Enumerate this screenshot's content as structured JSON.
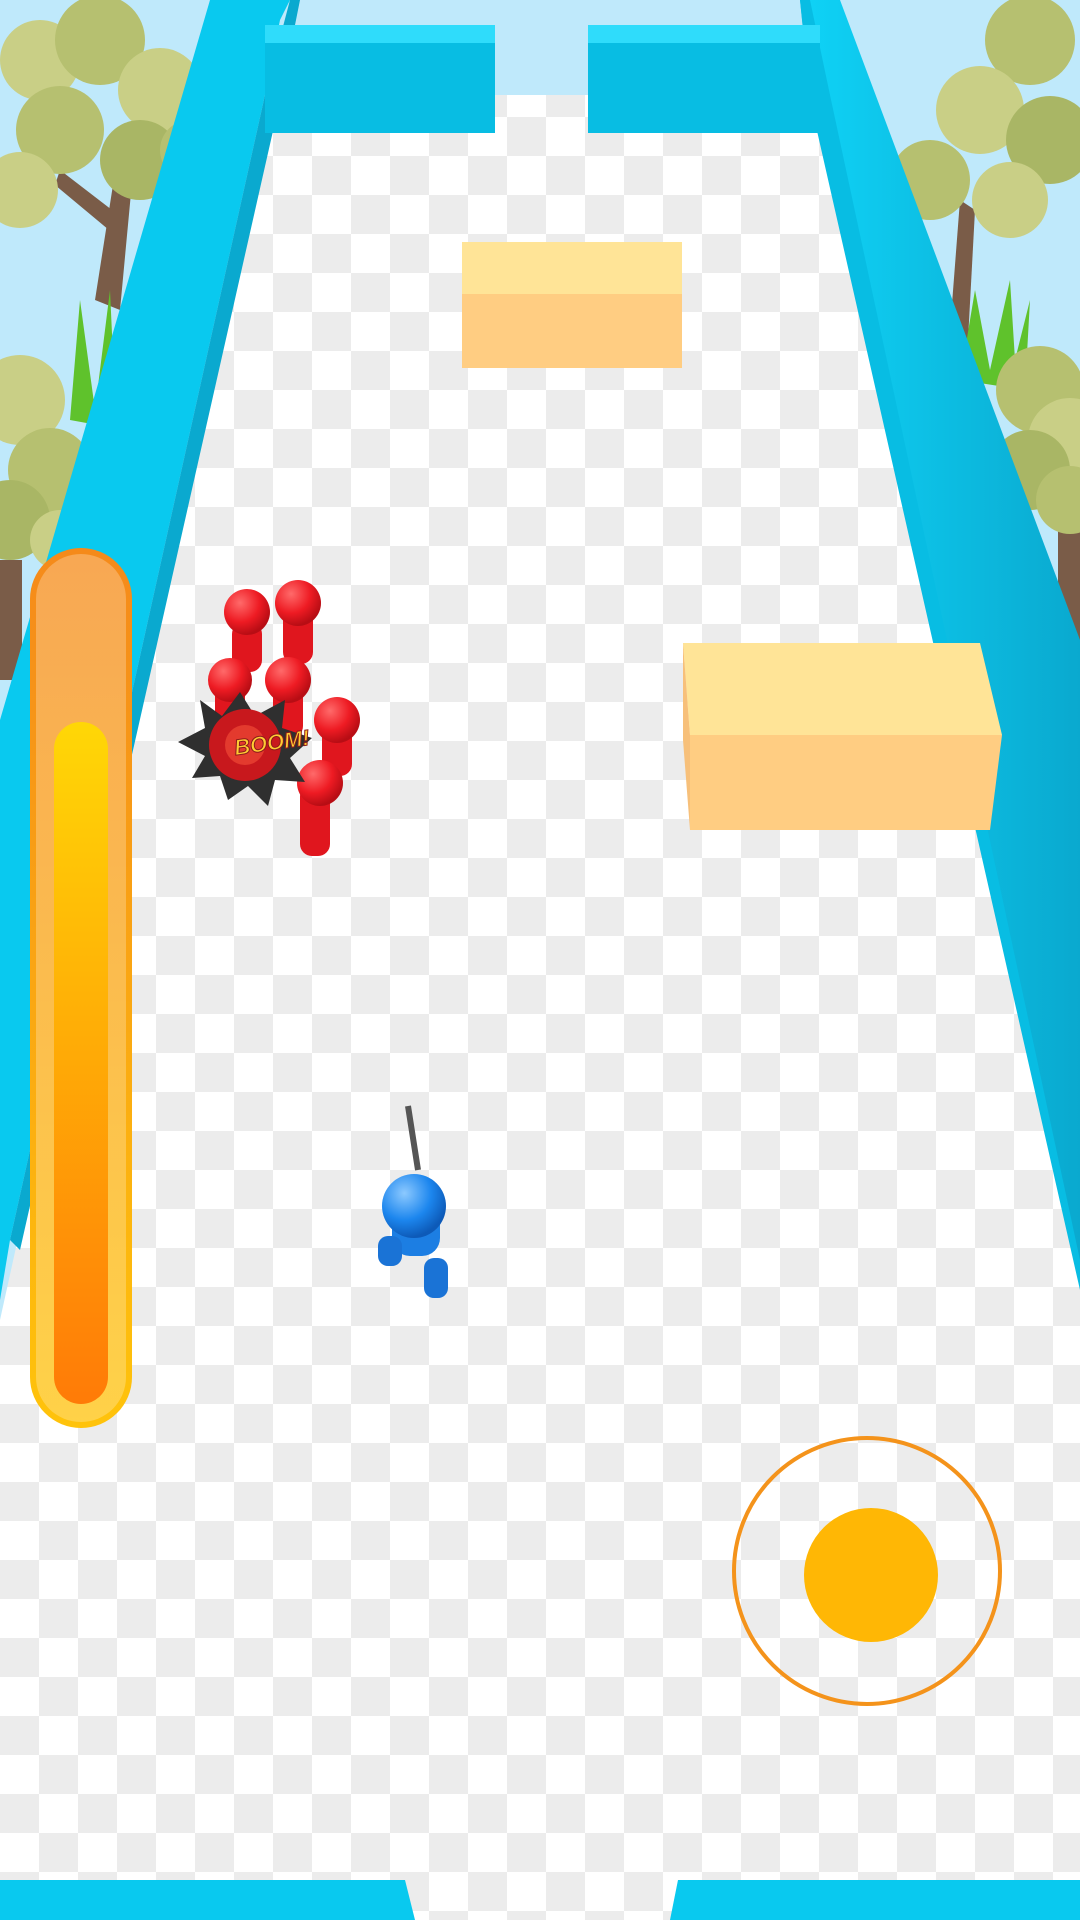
{
  "colors": {
    "wall": "#09c9ef",
    "wall_shadow": "#0ba4c9",
    "tile_light": "#ffffff",
    "tile_dark": "#efefef",
    "block_top": "#ffe497",
    "block_front": "#ffcd82",
    "enemy": "#ee1b23",
    "player": "#1c86ee",
    "accent_orange": "#f4931b",
    "accent_yellow": "#ffd500",
    "knob": "#ffb705",
    "sky": "#bfe9fb"
  },
  "effects": {
    "hit_text": "BOOM!"
  },
  "hud": {
    "energy_level": 0.82,
    "energy_gradient": [
      "#ffd706",
      "#ff7b07"
    ]
  },
  "joystick": {
    "ring_color": "#f4931b",
    "knob_color": "#ffb705"
  },
  "icons": {
    "tree": "low-poly-tree-icon",
    "grass": "grass-tuft-icon",
    "enemy": "red-stickman-icon",
    "player": "blue-stickman-icon",
    "weapon": "rifle-icon",
    "explosion": "boom-burst-icon"
  }
}
